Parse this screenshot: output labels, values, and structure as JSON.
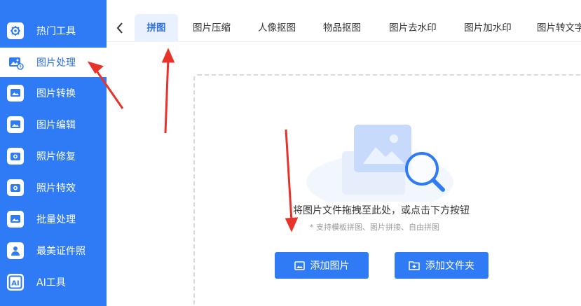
{
  "sidebar": {
    "items": [
      {
        "label": "热门工具",
        "icon": "gear-tools-icon"
      },
      {
        "label": "图片处理",
        "icon": "image-process-icon",
        "active": true
      },
      {
        "label": "图片转换",
        "icon": "image-convert-icon"
      },
      {
        "label": "图片编辑",
        "icon": "image-edit-icon"
      },
      {
        "label": "照片修复",
        "icon": "photo-repair-icon"
      },
      {
        "label": "照片特效",
        "icon": "photo-effect-icon"
      },
      {
        "label": "批量处理",
        "icon": "batch-process-icon"
      },
      {
        "label": "最美证件照",
        "icon": "id-photo-icon"
      },
      {
        "label": "AI工具",
        "icon": "ai-tools-icon"
      }
    ]
  },
  "tabs": [
    {
      "label": "拼图",
      "active": true
    },
    {
      "label": "图片压缩"
    },
    {
      "label": "人像抠图"
    },
    {
      "label": "物品抠图"
    },
    {
      "label": "图片去水印"
    },
    {
      "label": "图片加水印"
    },
    {
      "label": "图片转文字"
    }
  ],
  "upload": {
    "title": "将图片文件拖拽至此处，或点击下方按钮",
    "subtitle": "* 支持模板拼图、图片拼接、自由拼图",
    "add_image_label": "添加图片",
    "add_folder_label": "添加文件夹"
  },
  "colors": {
    "brand_blue": "#2f7bf5",
    "active_text": "#2f6fe6",
    "annotation_red": "#e8332b"
  }
}
